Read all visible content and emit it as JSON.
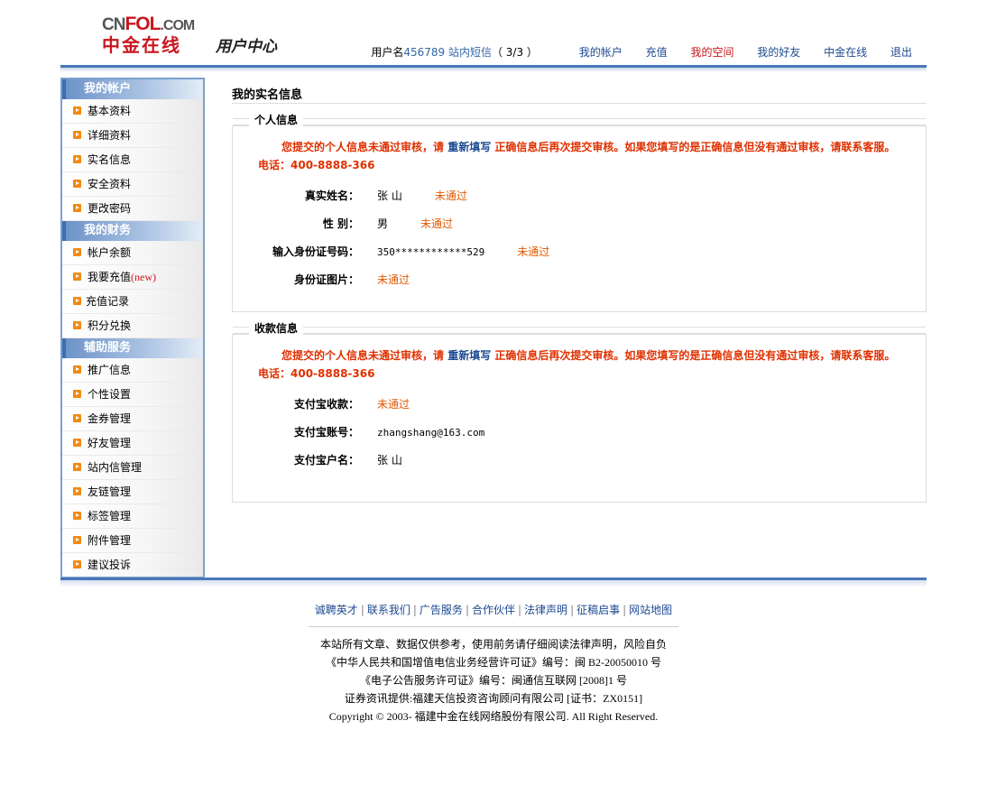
{
  "header": {
    "logo_top_cn": "CN",
    "logo_top_fol": "FOL",
    "logo_top_com": ".COM",
    "logo_cn": "中金在线",
    "logo_sub": "用户中心",
    "user_label": "用户名",
    "user_id": "456789",
    "sms_label": "站内短信",
    "sms_count": "（ 3/3 ）",
    "nav": [
      {
        "label": "我的帐户",
        "active": false
      },
      {
        "label": "充值",
        "active": false
      },
      {
        "label": "我的空间",
        "active": true
      },
      {
        "label": "我的好友",
        "active": false
      },
      {
        "label": "中金在线",
        "active": false
      },
      {
        "label": "退出",
        "active": false
      }
    ]
  },
  "sidebar": {
    "sections": [
      {
        "title": "我的帐户",
        "items": [
          "基本资料",
          "详细资料",
          "实名信息",
          "安全资料",
          "更改密码"
        ]
      },
      {
        "title": "我的财务",
        "items": [
          "帐户余额",
          "我要充值",
          "充值记录",
          "积分兑换"
        ],
        "new_tag": "(new)"
      },
      {
        "title": "辅助服务",
        "items": [
          "推广信息",
          "个性设置",
          "金券管理",
          "好友管理",
          "站内信管理",
          "友链管理",
          "标签管理",
          "附件管理",
          "建议投诉"
        ]
      }
    ]
  },
  "main": {
    "title": "我的实名信息",
    "personal": {
      "title": "个人信息",
      "notice_pre": "您提交的个人信息未通过审核，请",
      "notice_link": "重新填写",
      "notice_post": "正确信息后再次提交审核。如果您填写的是正确信息但没有通过审核，请联系客服。  电话：400-8888-366",
      "fields": [
        {
          "label": "真实姓名：",
          "value": "张  山",
          "status": "未通过"
        },
        {
          "label": "性   别：",
          "value": "男",
          "status": "未通过"
        },
        {
          "label": "输入身份证号码：",
          "value": "350************529",
          "status": "未通过"
        },
        {
          "label": "身份证图片：",
          "value": "",
          "status": "未通过"
        }
      ]
    },
    "payment": {
      "title": "收款信息",
      "notice_pre": "您提交的个人信息未通过审核，请",
      "notice_link": "重新填写",
      "notice_post": "正确信息后再次提交审核。如果您填写的是正确信息但没有通过审核，请联系客服。  电话：400-8888-366",
      "fields": [
        {
          "label": "支付宝收款：",
          "value": "",
          "status": "未通过"
        },
        {
          "label": "支付宝账号：",
          "value": "zhangshang@163.com",
          "status": ""
        },
        {
          "label": "支付宝户名：",
          "value": "张  山",
          "status": ""
        }
      ]
    }
  },
  "footer": {
    "links": [
      "诚聘英才",
      "联系我们",
      "广告服务",
      "合作伙伴",
      "法律声明",
      "征稿启事",
      "网站地图"
    ],
    "lines": [
      "本站所有文章、数据仅供参考，使用前务请仔细阅读法律声明，风险自负",
      "《中华人民共和国增值电信业务经营许可证》编号：闽  B2-20050010 号",
      "《电子公告服务许可证》编号：闽通信互联网  [2008]1 号",
      "证券资讯提供:福建天信投资咨询顾问有限公司  [证书：ZX0151]",
      "Copyright © 2003- 福建中金在线网络股份有限公司. All Right Reserved."
    ]
  },
  "colors": {
    "accent_blue": "#4a78b8",
    "link_blue": "#1d4a91",
    "alert_red": "#e03000",
    "fail_orange": "#e05a00",
    "active_red": "#c8161d"
  }
}
